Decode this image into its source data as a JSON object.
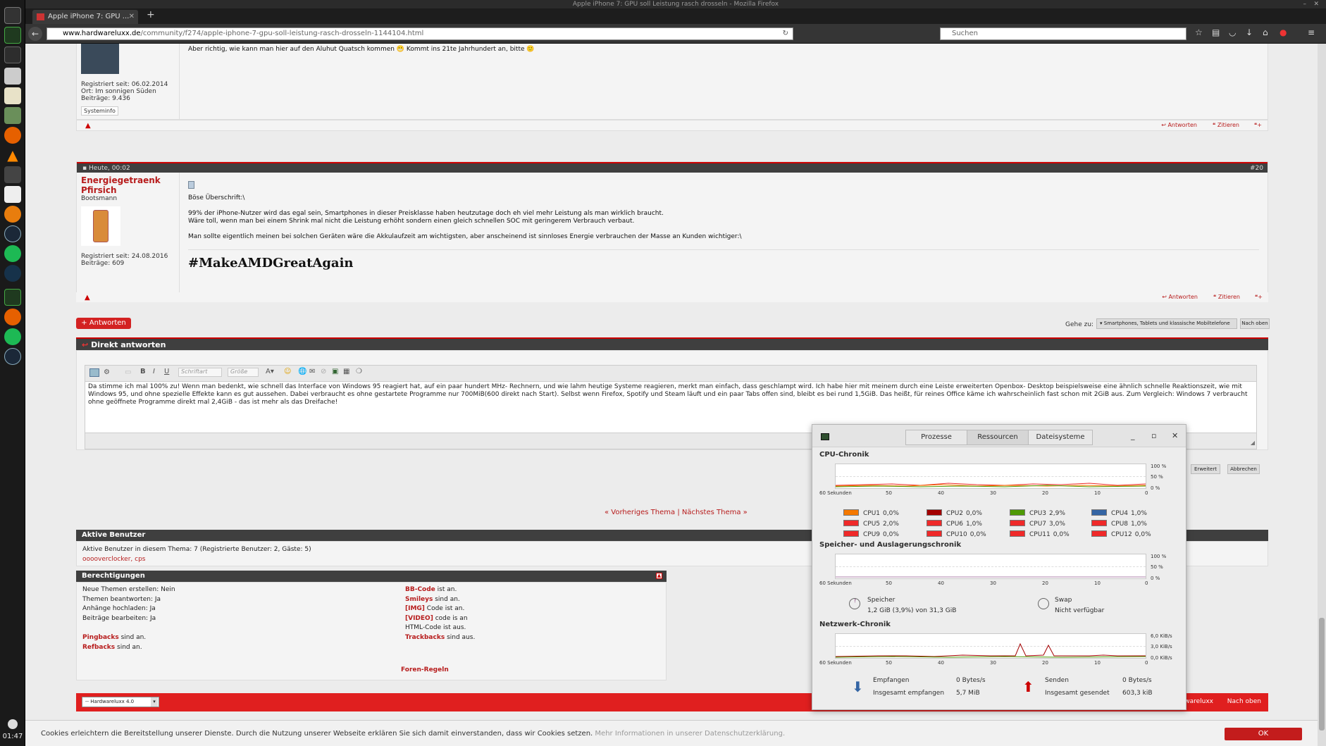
{
  "window": {
    "title": "Apple iPhone 7: GPU soll Leistung rasch drosseln - Mozilla Firefox",
    "tab_label": "Apple iPhone 7: GPU ...",
    "url_host": "www.hardwareluxx.de",
    "url_path": "/community/f274/apple-iphone-7-gpu-soll-leistung-rasch-drosseln-1144104.html",
    "search_placeholder": "Suchen"
  },
  "taskbar": {
    "time": "01:47",
    "icons": [
      "menu-icon",
      "system-monitor-icon",
      "terminal-icon",
      "files-icon",
      "text-editor-icon",
      "calculator-icon",
      "firefox-icon",
      "vlc-icon",
      "wing-icon",
      "document-icon",
      "blender-icon",
      "steam-icon",
      "spotify-icon",
      "wave-icon",
      "system-monitor-icon",
      "firefox-icon",
      "spotify-icon",
      "steam-icon"
    ]
  },
  "post1": {
    "text": "Aber richtig, wie kann man hier auf den Aluhut Quatsch kommen 😬 Kommt ins 21te Jahrhundert an, bitte 🙂",
    "registered": "Registriert seit: 06.02.2014",
    "location": "Ort: Im sonnigen Süden",
    "posts": "Beiträge: 9.436",
    "sysinfo": "Systeminfo",
    "reply": "Antworten",
    "quote": "Zitieren"
  },
  "post2": {
    "date": "Heute, 00:02",
    "number": "#20",
    "username": "Energiegetraenk Pfirsich",
    "rank": "Bootsmann",
    "registered": "Registriert seit: 24.08.2016",
    "posts": "Beiträge: 609",
    "line1": "Böse Überschrift:\\",
    "line2": "99% der iPhone-Nutzer wird das egal sein, Smartphones in dieser Preisklasse haben heutzutage doch eh viel mehr Leistung als man wirklich braucht.",
    "line3": "Wäre toll, wenn man bei einem Shrink mal nicht die Leistung erhöht sondern einen gleich schnellen SOC mit geringerem Verbrauch verbaut.",
    "line4": "Man sollte eigentlich meinen bei solchen Geräten wäre die Akkulaufzeit am wichtigsten, aber anscheinend ist sinnloses Energie verbrauchen der Masse an Kunden wichtiger:\\",
    "signature": "#MakeAMDGreatAgain",
    "reply": "Antworten",
    "quote": "Zitieren"
  },
  "controls": {
    "answer_button": "+ Antworten",
    "goto_label": "Gehe zu:",
    "goto_value": "Smartphones, Tablets und klassische Mobiltelefone",
    "to_top": "Nach oben"
  },
  "quickreply": {
    "title": "Direkt antworten",
    "font_placeholder": "Schriftart",
    "size_placeholder": "Größe",
    "text": "Da stimme ich mal 100% zu! Wenn man bedenkt, wie schnell das Interface von Windows 95 reagiert hat, auf ein paar hundert MHz- Rechnern, und wie lahm heutige Systeme reagieren, merkt man einfach, dass geschlampt wird. Ich habe hier mit meinem durch eine Leiste erweiterten Openbox- Desktop beispielsweise eine ähnlich schnelle Reaktionszeit, wie mit Windows 95, und ohne spezielle Effekte kann es gut aussehen. Dabei verbraucht es ohne gestartete Programme nur 700MiB(600 direkt nach Start). Selbst wenn Firefox, Spotify und Steam läuft und ein paar Tabs offen sind, bleibt es bei rund 1,5GiB. Das heißt, für reines Office käme ich wahrscheinlich fast schon mit 2GiB aus. Zum Vergleich: Windows 7 verbraucht ohne geöffnete Programme direkt mal 2,4GiB - das ist mehr als das Dreifache!",
    "advanced": "Erweitert",
    "cancel": "Abbrechen"
  },
  "thread_nav": "« Vorheriges Thema | Nächstes Thema »",
  "active_users": {
    "title": "Aktive Benutzer",
    "summary": "Aktive Benutzer in diesem Thema: 7 (Registrierte Benutzer: 2, Gäste: 5)",
    "users": "ooooverclocker, cps"
  },
  "permissions": {
    "title": "Berechtigungen",
    "left": [
      "Neue Themen erstellen: Nein",
      "Themen beantworten: Ja",
      "Anhänge hochladen: Ja",
      "Beiträge bearbeiten: Ja"
    ],
    "bb": "BB-Code",
    "bb_s": "ist an.",
    "smilies": "Smileys",
    "smilies_s": "sind an.",
    "img": "[IMG]",
    "img_s": "Code ist an.",
    "video": "[VIDEO]",
    "video_s": "code is an",
    "html": "HTML-Code ist aus.",
    "trackbacks": "Trackbacks",
    "trackbacks_s": "sind aus.",
    "pingbacks": "Pingbacks",
    "pingbacks_s": "sind an.",
    "refbacks": "Refbacks",
    "refbacks_s": "sind an.",
    "rules": "Foren-Regeln"
  },
  "footer": {
    "style_select": "-- Hardwareluxx 4.0",
    "brand": "Hardwareluxx",
    "to_top": "Nach oben"
  },
  "cookie": {
    "text": "Cookies erleichtern die Bereitstellung unserer Dienste. Durch die Nutzung unserer Webseite erklären Sie sich damit einverstanden, dass wir Cookies setzen.",
    "more": "Mehr Informationen in unserer Datenschutzerklärung.",
    "ok": "OK"
  },
  "sysmon": {
    "tabs": [
      "Prozesse",
      "Ressourcen",
      "Dateisysteme"
    ],
    "active_tab": "Ressourcen",
    "cpu_title": "CPU-Chronik",
    "mem_title": "Speicher- und Auslagerungschronik",
    "net_title": "Netzwerk-Chronik",
    "x_ticks": [
      "60 Sekunden",
      "50",
      "40",
      "30",
      "20",
      "10",
      "0"
    ],
    "pct_ticks": [
      "100 %",
      "50 %",
      "0 %"
    ],
    "net_ticks": [
      "6,0 KiB/s",
      "3,0 KiB/s",
      "0,0 KiB/s"
    ],
    "cpus": [
      {
        "label": "CPU1",
        "value": "0,0%",
        "color": "#f57900"
      },
      {
        "label": "CPU2",
        "value": "0,0%",
        "color": "#a40000"
      },
      {
        "label": "CPU3",
        "value": "2,9%",
        "color": "#4e9a06"
      },
      {
        "label": "CPU4",
        "value": "1,0%",
        "color": "#3465a4"
      },
      {
        "label": "CPU5",
        "value": "2,0%",
        "color": "#ef2929"
      },
      {
        "label": "CPU6",
        "value": "1,0%",
        "color": "#ef2929"
      },
      {
        "label": "CPU7",
        "value": "3,0%",
        "color": "#ef2929"
      },
      {
        "label": "CPU8",
        "value": "1,0%",
        "color": "#ef2929"
      },
      {
        "label": "CPU9",
        "value": "0,0%",
        "color": "#ef2929"
      },
      {
        "label": "CPU10",
        "value": "0,0%",
        "color": "#ef2929"
      },
      {
        "label": "CPU11",
        "value": "0,0%",
        "color": "#ef2929"
      },
      {
        "label": "CPU12",
        "value": "0,0%",
        "color": "#ef2929"
      }
    ],
    "mem_label": "Speicher",
    "mem_value": "1,2 GiB (3,9%) von 31,3 GiB",
    "swap_label": "Swap",
    "swap_value": "Nicht verfügbar",
    "recv_label": "Empfangen",
    "recv_rate": "0 Bytes/s",
    "recv_total_label": "Insgesamt empfangen",
    "recv_total": "5,7 MiB",
    "send_label": "Senden",
    "send_rate": "0 Bytes/s",
    "send_total_label": "Insgesamt gesendet",
    "send_total": "603,3 kiB"
  }
}
